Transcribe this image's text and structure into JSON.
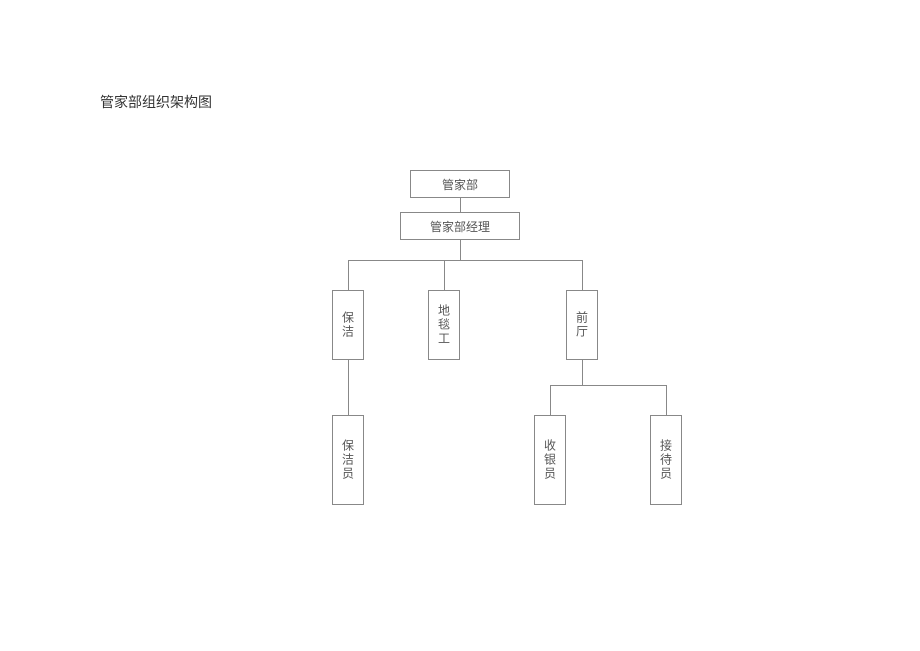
{
  "title": "管家部组织架构图",
  "org": {
    "root": "管家部",
    "manager": "管家部经理",
    "cleaning": "保洁",
    "carpet": "地毯工",
    "front": "前厅",
    "cleaner": "保洁员",
    "cashier": "收银员",
    "receptionist": "接待员"
  }
}
